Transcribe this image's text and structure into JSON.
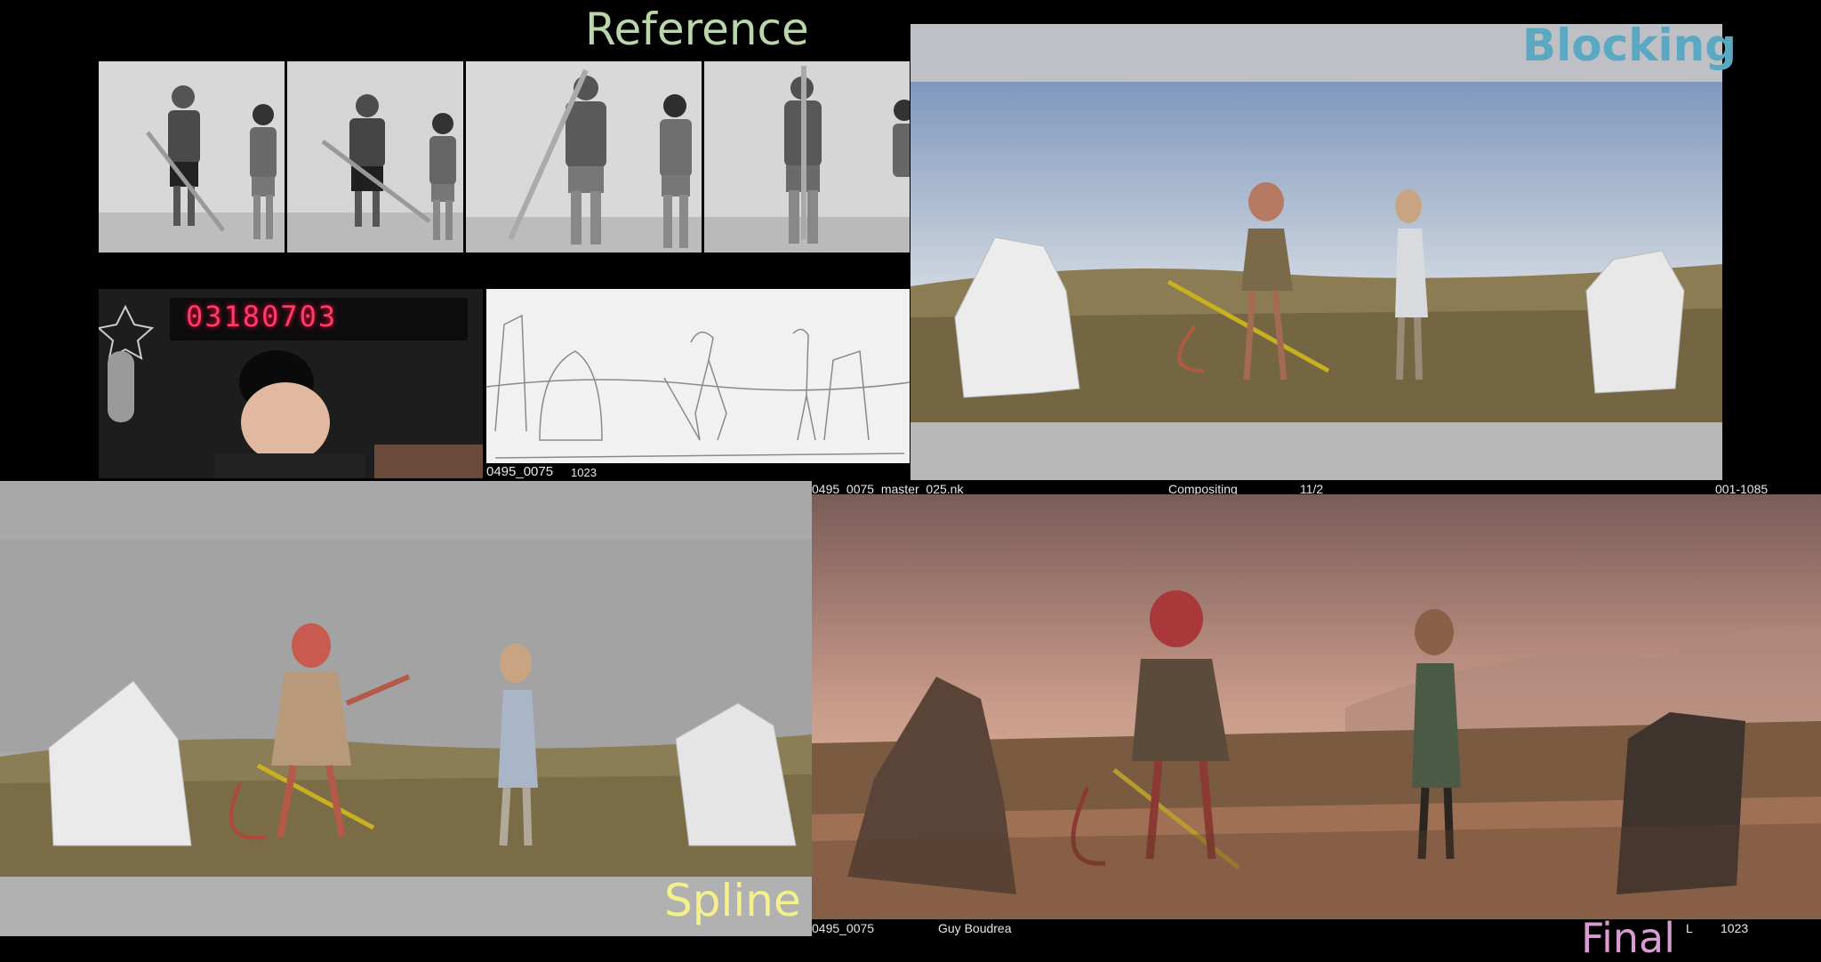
{
  "labels": {
    "reference": "Reference",
    "blocking": "Blocking",
    "spline": "Spline",
    "final": "Final"
  },
  "timecode": "03180703",
  "overlays": {
    "storyboard_shot": "0495_0075",
    "storyboard_frame": "1023",
    "nuke_script": "0495_0075_master_025.nk",
    "stage": "Compositing",
    "ratio": "11/2",
    "frame_range": "001-1085",
    "final_shot": "0495_0075",
    "artist": "Guy Boudrea",
    "eye": "L",
    "final_frame": "1023"
  },
  "colors": {
    "reference_label": "#bcd6ac",
    "blocking_label": "#5ba8c2",
    "spline_label": "#f4f08a",
    "final_label": "#d99cd0",
    "timecode": "#ff3b66"
  }
}
